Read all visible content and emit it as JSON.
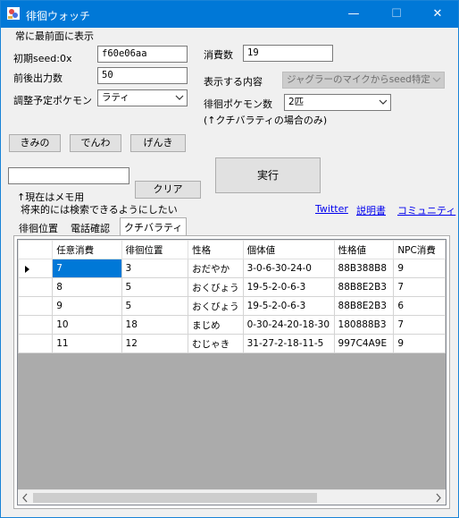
{
  "window": {
    "title": "徘徊ウォッチ",
    "minimize": "—",
    "maximize": "☐",
    "close": "✕"
  },
  "menu": {
    "always_on_top": "常に最前面に表示"
  },
  "form": {
    "initial_seed_label": "初期seed:0x",
    "initial_seed_value": "f60e06aa",
    "output_count_label": "前後出力数",
    "output_count_value": "50",
    "pokemon_label": "調整予定ポケモン",
    "pokemon_value": "ラティ",
    "consume_label": "消費数",
    "consume_value": "19",
    "display_label": "表示する内容",
    "display_value": "ジャグラーのマイクからseed特定",
    "roamer_count_label": "徘徊ポケモン数",
    "roamer_count_value": "2匹",
    "roamer_note": "(↑クチバラティの場合のみ)"
  },
  "buttons": {
    "kimino": "きみの",
    "denwa": "でんわ",
    "genki": "げんき",
    "clear": "クリア",
    "run": "実行"
  },
  "memo": {
    "value": "",
    "note_line1": "↑現在はメモ用",
    "note_line2": "将来的には検索できるようにしたい"
  },
  "links": {
    "twitter": "Twitter",
    "manual": "説明書",
    "community": "コミュニティ"
  },
  "tabs": [
    "徘徊位置",
    "電話確認",
    "クチバラティ"
  ],
  "active_tab": 2,
  "grid": {
    "columns": [
      "任意消費",
      "徘徊位置",
      "性格",
      "個体値",
      "性格値",
      "NPC消費"
    ],
    "rows": [
      [
        "7",
        "3",
        "おだやか",
        "3-0-6-30-24-0",
        "88B388B8",
        "9"
      ],
      [
        "8",
        "5",
        "おくびょう",
        "19-5-2-0-6-3",
        "88B8E2B3",
        "7"
      ],
      [
        "9",
        "5",
        "おくびょう",
        "19-5-2-0-6-3",
        "88B8E2B3",
        "6"
      ],
      [
        "10",
        "18",
        "まじめ",
        "0-30-24-20-18-30",
        "180888B3",
        "7"
      ],
      [
        "11",
        "12",
        "むじゃき",
        "31-27-2-18-11-5",
        "997C4A9E",
        "9"
      ]
    ],
    "current_row": 0
  },
  "colors": {
    "titlebar": "#0078d7",
    "selection": "#0078d7",
    "grid_empty": "#ababab",
    "link": "#0000ee"
  }
}
